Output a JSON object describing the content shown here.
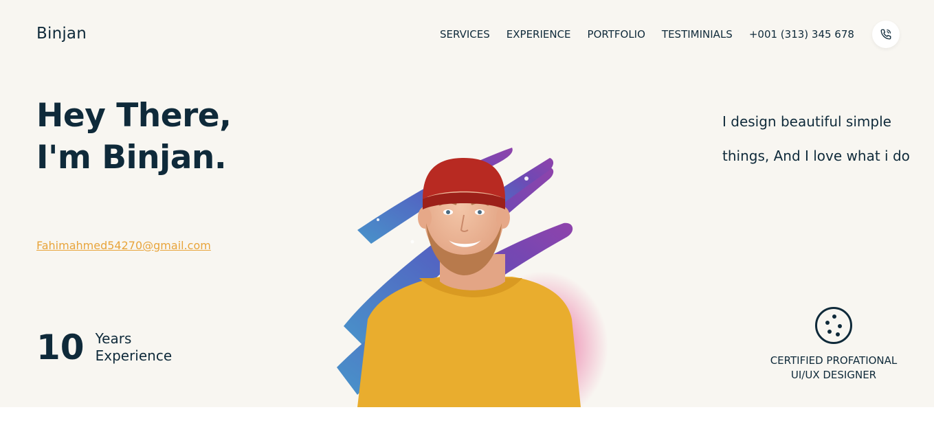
{
  "header": {
    "logo": "Binjan",
    "nav": [
      {
        "label": "SERVICES"
      },
      {
        "label": "EXPERIENCE"
      },
      {
        "label": "PORTFOLIO"
      },
      {
        "label": "TESTIMINIALS"
      }
    ],
    "phone": "+001 (313) 345 678",
    "phone_icon": "phone-icon"
  },
  "hero": {
    "headline_line1": "Hey There,",
    "headline_line2": "I'm Binjan.",
    "email": "Fahimahmed54270@gmail.com",
    "experience_number": "10",
    "experience_label_line1": "Years",
    "experience_label_line2": "Experience",
    "tagline_line1": "I design beautiful simple",
    "tagline_line2": "things, And I love what i do",
    "cert_icon": "dots-badge-icon",
    "cert_line1": "CERTIFIED PROFATIONAL",
    "cert_line2": "UI/UX DESIGNER"
  },
  "colors": {
    "background": "#f8f6f1",
    "text": "#0f2a3a",
    "accent": "#e8a43a",
    "sweater": "#e9ad2e",
    "beanie": "#b82a22"
  }
}
